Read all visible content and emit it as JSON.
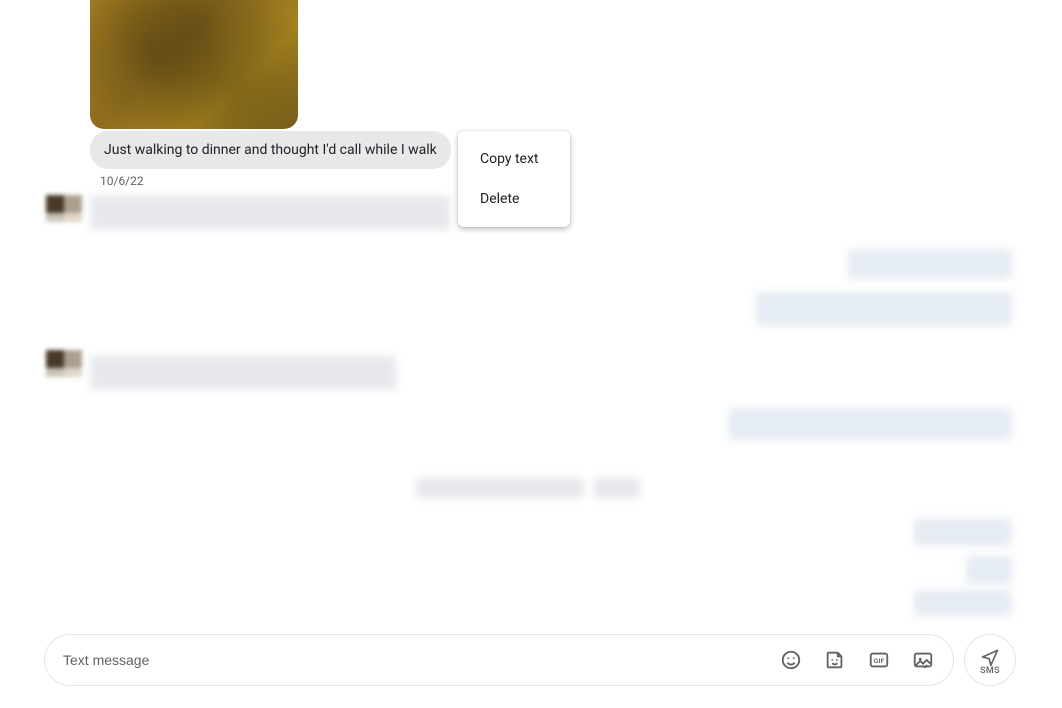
{
  "message": {
    "text": "Just walking to dinner and thought I'd call while I walk",
    "timestamp": "10/6/22"
  },
  "contextMenu": {
    "copy": "Copy text",
    "delete": "Delete"
  },
  "composer": {
    "placeholder": "Text message"
  },
  "send": {
    "label": "SMS"
  }
}
